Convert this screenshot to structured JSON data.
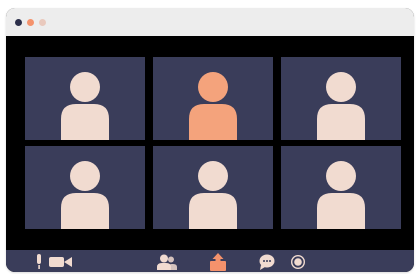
{
  "window": {
    "traffic_lights": [
      {
        "name": "close",
        "color": "#2c2f4a"
      },
      {
        "name": "minimize",
        "color": "#f4926c"
      },
      {
        "name": "maximize",
        "color": "#e9c9bd"
      }
    ]
  },
  "participants": [
    {
      "id": 1,
      "avatar_color": "#f1dbd0",
      "active_speaker": false
    },
    {
      "id": 2,
      "avatar_color": "#f4a37c",
      "active_speaker": true
    },
    {
      "id": 3,
      "avatar_color": "#f1dbd0",
      "active_speaker": false
    },
    {
      "id": 4,
      "avatar_color": "#f1dbd0",
      "active_speaker": false
    },
    {
      "id": 5,
      "avatar_color": "#f1dbd0",
      "active_speaker": false
    },
    {
      "id": 6,
      "avatar_color": "#f1dbd0",
      "active_speaker": false
    }
  ],
  "toolbar": {
    "buttons": [
      {
        "name": "microphone-button",
        "icon": "microphone-icon"
      },
      {
        "name": "camera-button",
        "icon": "video-camera-icon"
      },
      {
        "name": "participants-button",
        "icon": "participants-icon"
      },
      {
        "name": "share-screen-button",
        "icon": "share-screen-icon"
      },
      {
        "name": "chat-button",
        "icon": "chat-bubble-icon"
      },
      {
        "name": "record-button",
        "icon": "record-icon"
      }
    ]
  },
  "colors": {
    "tile_background": "#3a3d5a",
    "toolbar_background": "#3a3d5a",
    "frame": "#000000",
    "titlebar": "#ededed",
    "icon_light": "#f1dbd0",
    "icon_accent": "#f4926c"
  }
}
